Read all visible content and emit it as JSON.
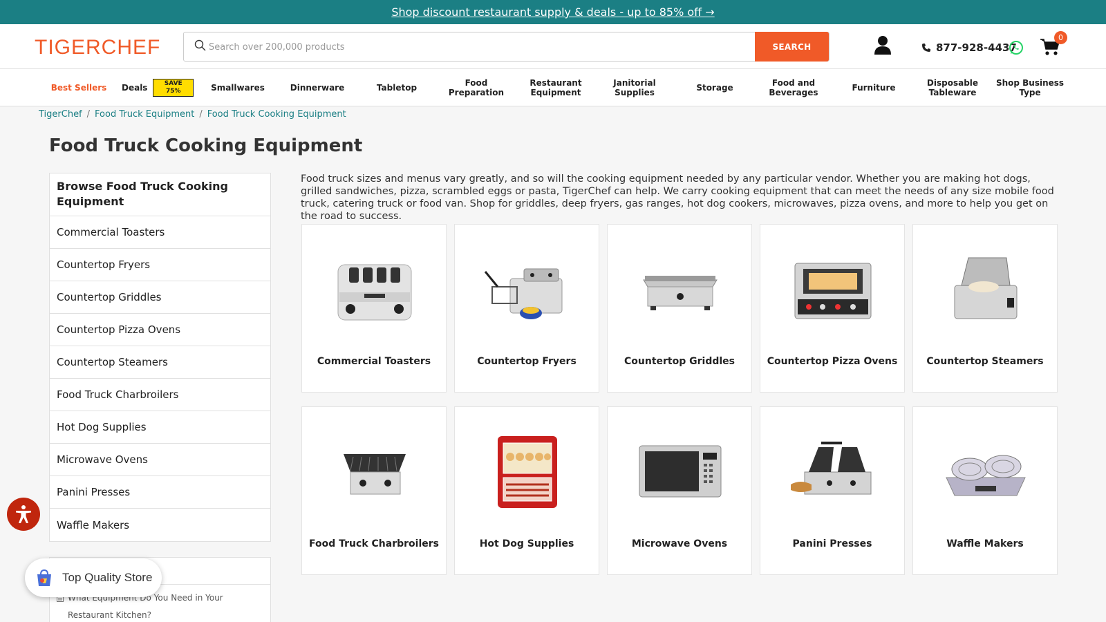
{
  "promo": {
    "text": "Shop discount restaurant supply & deals - up to 85% off →"
  },
  "header": {
    "logo": "TIGERCHEF",
    "search_placeholder": "Search over 200,000 products",
    "search_button": "SEARCH",
    "phone": "877-928-4437",
    "cart_count": "0"
  },
  "nav": {
    "items": [
      {
        "label": "Best Sellers",
        "accent": true
      },
      {
        "label": "Deals",
        "badge": "SAVE 75%"
      },
      {
        "label": "Smallwares"
      },
      {
        "label": "Dinnerware"
      },
      {
        "label": "Tabletop"
      },
      {
        "label": "Food Preparation"
      },
      {
        "label": "Restaurant Equipment"
      },
      {
        "label": "Janitorial Supplies"
      },
      {
        "label": "Storage"
      },
      {
        "label": "Food and Beverages"
      },
      {
        "label": "Furniture"
      },
      {
        "label": "Disposable Tableware"
      },
      {
        "label": "Shop Business Type"
      }
    ]
  },
  "breadcrumb": [
    "TigerChef",
    "Food Truck Equipment",
    "Food Truck Cooking Equipment"
  ],
  "page_title": "Food Truck Cooking Equipment",
  "sidebar": {
    "heading": "Browse Food Truck Cooking Equipment",
    "items": [
      "Commercial Toasters",
      "Countertop Fryers",
      "Countertop Griddles",
      "Countertop Pizza Ovens",
      "Countertop Steamers",
      "Food Truck Charbroilers",
      "Hot Dog Supplies",
      "Microwave Ovens",
      "Panini Presses",
      "Waffle Makers"
    ],
    "article": "What Equipment Do You Need in Your Restaurant Kitchen?"
  },
  "intro": "Food truck sizes and menus vary greatly, and so will the cooking equipment needed by any particular vendor. Whether you are making hot dogs, grilled sandwiches, pizza, scrambled eggs or pasta, TigerChef can help. We carry cooking equipment that can meet the needs of any size mobile food truck, catering truck or food van. Shop for griddles, deep fryers, gas ranges, hot dog cookers, microwaves, pizza ovens, and more to help you get on the road to success.",
  "categories": [
    {
      "label": "Commercial Toasters",
      "icon": "toaster-icon"
    },
    {
      "label": "Countertop Fryers",
      "icon": "fryer-icon"
    },
    {
      "label": "Countertop Griddles",
      "icon": "griddle-icon"
    },
    {
      "label": "Countertop Pizza Ovens",
      "icon": "pizza-oven-icon"
    },
    {
      "label": "Countertop Steamers",
      "icon": "steamer-icon"
    },
    {
      "label": "Food Truck Charbroilers",
      "icon": "charbroiler-icon"
    },
    {
      "label": "Hot Dog Supplies",
      "icon": "hot-dog-cabinet-icon"
    },
    {
      "label": "Microwave Ovens",
      "icon": "microwave-icon"
    },
    {
      "label": "Panini Presses",
      "icon": "panini-press-icon"
    },
    {
      "label": "Waffle Makers",
      "icon": "waffle-maker-icon"
    }
  ],
  "widgets": {
    "shop_pill": "Top Quality Store"
  },
  "colors": {
    "teal": "#1b7f84",
    "orange": "#f05a28",
    "deal_yellow": "#ffdd00",
    "access_red": "#c0260d"
  }
}
